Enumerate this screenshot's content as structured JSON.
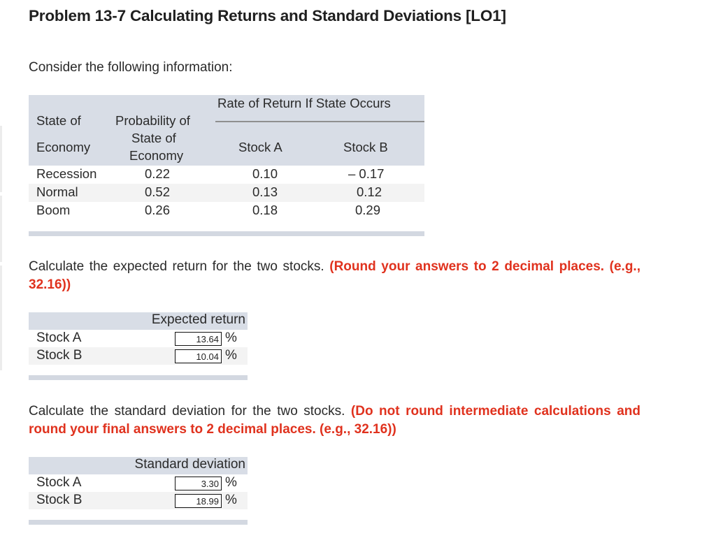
{
  "title": "Problem 13-7 Calculating Returns and Standard Deviations [LO1]",
  "intro": "Consider the following information:",
  "info_table": {
    "group_header": "Rate of Return If State Occurs",
    "col_state": [
      "State of",
      "Economy"
    ],
    "col_prob": [
      "Probability of",
      "State of",
      "Economy"
    ],
    "col_a": "Stock A",
    "col_b": "Stock B",
    "rows": [
      {
        "state": "Recession",
        "prob": "0.22",
        "a": "0.10",
        "b": "– 0.17"
      },
      {
        "state": "Normal",
        "prob": "0.52",
        "a": "0.13",
        "b": "0.12"
      },
      {
        "state": "Boom",
        "prob": "0.26",
        "a": "0.18",
        "b": "0.29"
      }
    ]
  },
  "q1": {
    "text": "Calculate the expected return for the two stocks.",
    "note": "(Round your answers to 2 decimal places. (e.g., 32.16))",
    "header": "Expected return",
    "rows": [
      {
        "label": "Stock A",
        "value": "13.64",
        "unit": "%"
      },
      {
        "label": "Stock B",
        "value": "10.04",
        "unit": "%"
      }
    ]
  },
  "q2": {
    "text": "Calculate the standard deviation for the two stocks.",
    "note": "(Do not round intermediate calculations and round your final answers to 2 decimal places. (e.g., 32.16))",
    "header": "Standard deviation",
    "rows": [
      {
        "label": "Stock A",
        "value": "3.30",
        "unit": "%"
      },
      {
        "label": "Stock B",
        "value": "18.99",
        "unit": "%"
      }
    ]
  }
}
